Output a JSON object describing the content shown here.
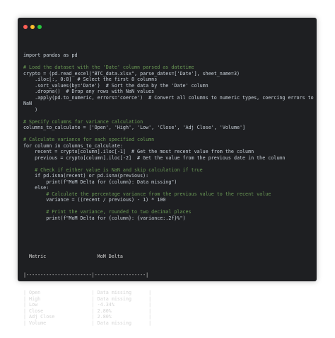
{
  "window": {
    "dots": [
      {
        "name": "close-dot",
        "color": "#ff5f56"
      },
      {
        "name": "minimize-dot",
        "color": "#ffbd2e"
      },
      {
        "name": "maximize-dot",
        "color": "#27c93f"
      }
    ]
  },
  "code_lines": [
    "import pandas as pd",
    "",
    "# Load the dataset with the 'Date' column parsed as datetime",
    "crypto = (pd.read_excel(\"BTC_data.xlsx\", parse_dates=['Date'], sheet_name=3)",
    "    .iloc[:, 0:8]  # Select the first 8 columns",
    "    .sort_values(by='Date')  # Sort the data by the 'Date' column",
    "    .dropna()  # Drop any rows with NaN values",
    "    .apply(pd.to_numeric, errors='coerce')  # Convert all columns to numeric types, coercing errors to",
    "NaN",
    "    )",
    "",
    "# Specify columns for variance calculation",
    "columns_to_calculate = ['Open', 'High', 'Low', 'Close', 'Adj Close', 'Volume']",
    "",
    "# Calculate variance for each specified column",
    "for column in columns_to_calculate:",
    "    recent = crypto[column].iloc[-1]  # Get the most recent value from the column",
    "    previous = crypto[column].iloc[-2]  # Get the value from the previous date in the column",
    "",
    "    # Check if either value is NaN and skip calculation if true",
    "    if pd.isna(recent) or pd.isna(previous):",
    "        print(f\"MoM Delta for {column}: Data missing\")",
    "    else:",
    "        # Calculate the percentage variance from the previous value to the recent value",
    "        variance = ((recent / previous) - 1) * 100",
    "",
    "        # Print the variance, rounded to two decimal places",
    "        print(f\"MoM Delta for {column}: {variance:.2f}%\")"
  ],
  "output": {
    "header": "  Metric                  MoM Delta",
    "rule": "|-----------------------|------------------|",
    "rows": [
      {
        "metric": "Open",
        "value": "Data missing"
      },
      {
        "metric": "High",
        "value": "Data missing"
      },
      {
        "metric": "Low",
        "value": "-4.34%"
      },
      {
        "metric": "Close",
        "value": "2.80%"
      },
      {
        "metric": "Adj Close",
        "value": "2.80%"
      },
      {
        "metric": "Volume",
        "value": "Data missing"
      }
    ]
  }
}
